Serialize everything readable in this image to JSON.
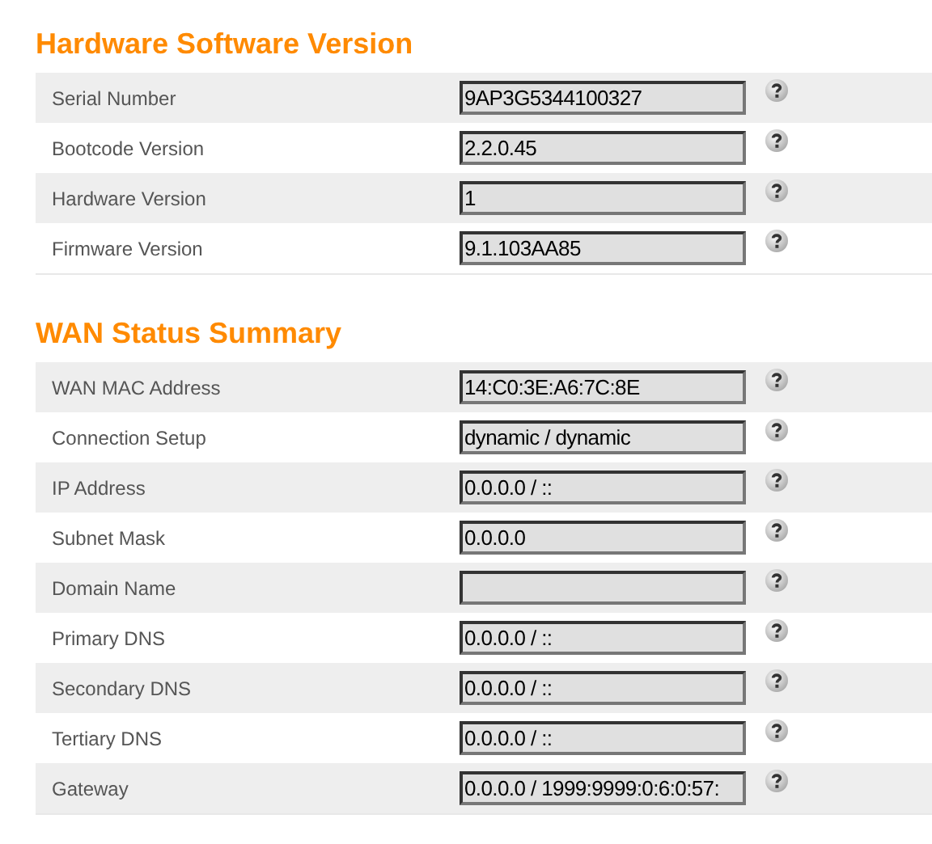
{
  "sections": [
    {
      "title": "Hardware Software Version",
      "rows": [
        {
          "label": "Serial Number",
          "value": "9AP3G5344100327"
        },
        {
          "label": "Bootcode Version",
          "value": "2.2.0.45"
        },
        {
          "label": "Hardware Version",
          "value": "1"
        },
        {
          "label": "Firmware Version",
          "value": "9.1.103AA85"
        }
      ]
    },
    {
      "title": "WAN Status Summary",
      "rows": [
        {
          "label": "WAN MAC Address",
          "value": "14:C0:3E:A6:7C:8E"
        },
        {
          "label": "Connection Setup",
          "value": "dynamic / dynamic"
        },
        {
          "label": "IP Address",
          "value": "0.0.0.0 / ::"
        },
        {
          "label": "Subnet Mask",
          "value": "0.0.0.0"
        },
        {
          "label": "Domain Name"
        },
        {
          "label": "Primary DNS",
          "value": "0.0.0.0 / ::"
        },
        {
          "label": "Secondary DNS",
          "value": "0.0.0.0 / ::"
        },
        {
          "label": "Tertiary DNS",
          "value": "0.0.0.0 / ::"
        },
        {
          "label": "Gateway",
          "value": "0.0.0.0 / 1999:9999:0:6:0:57:"
        }
      ]
    }
  ]
}
